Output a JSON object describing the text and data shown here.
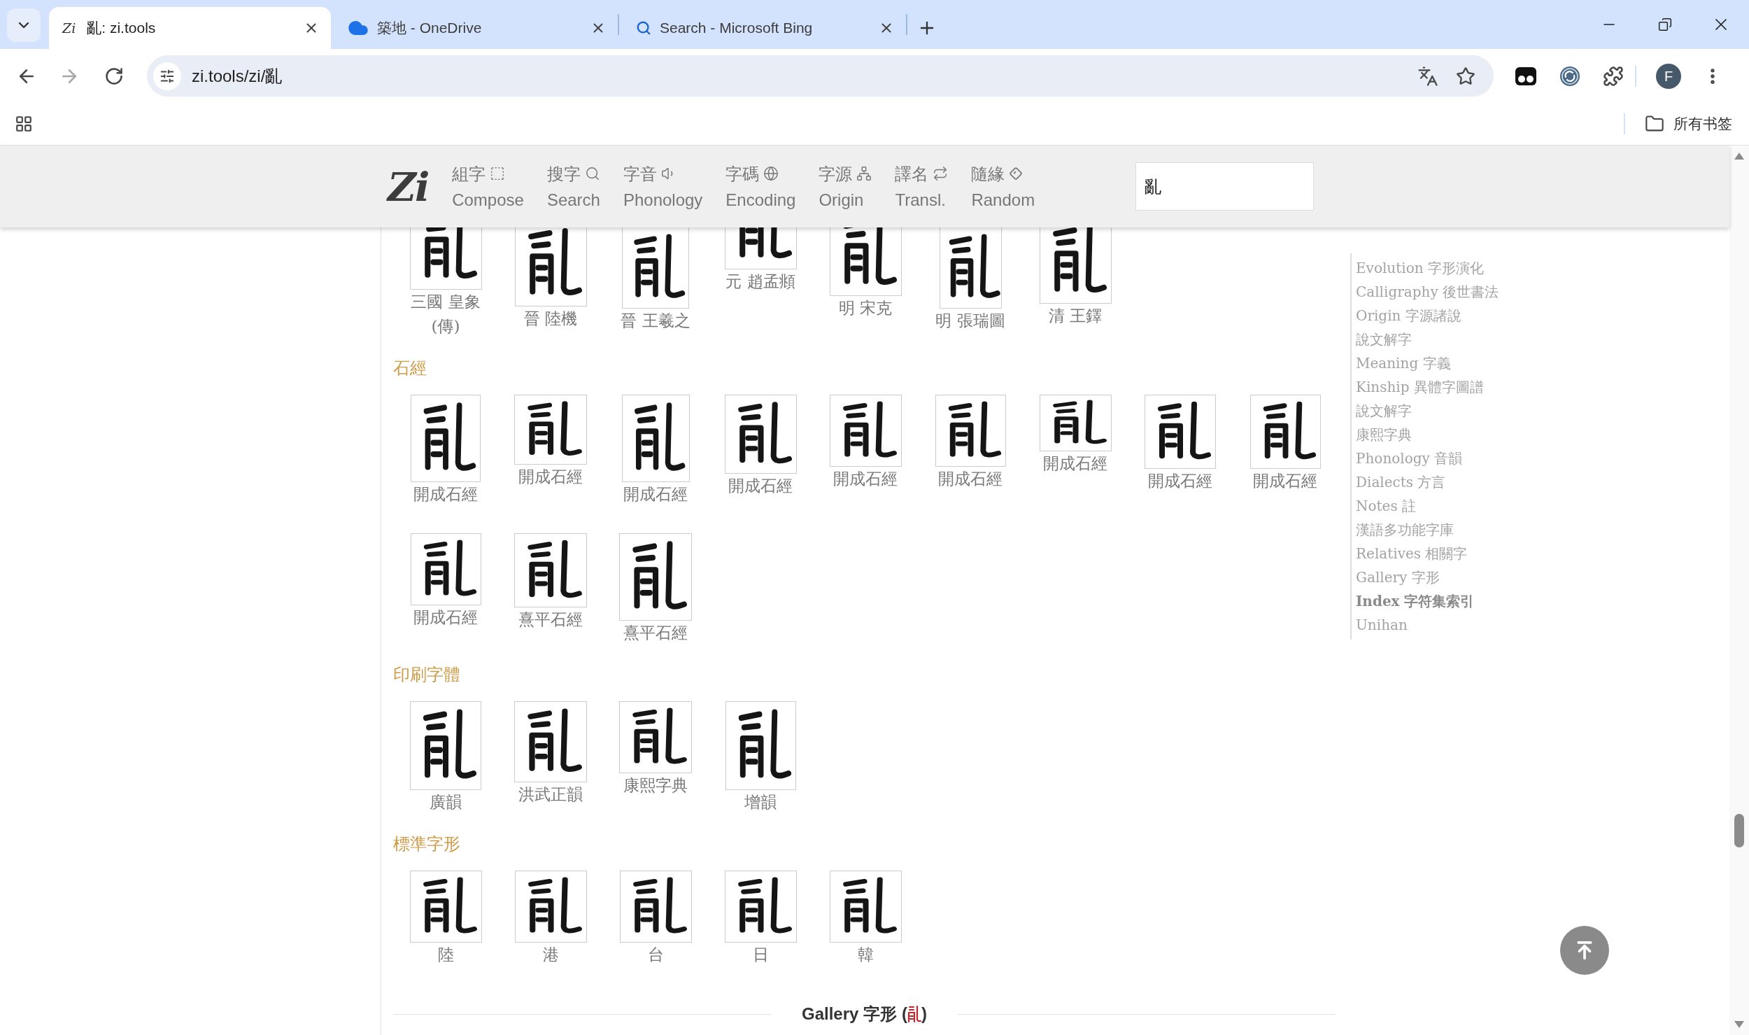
{
  "browser": {
    "tabs": [
      {
        "kind": "site",
        "favicon": "Zi",
        "title": "亂: zi.tools",
        "selected": true
      },
      {
        "kind": "cloud",
        "title": "築地 - OneDrive",
        "selected": false
      },
      {
        "kind": "search",
        "title": "Search - Microsoft Bing",
        "selected": false
      }
    ],
    "address": "zi.tools/zi/亂",
    "profile_initial": "F",
    "bookmarks_folder": "所有书签"
  },
  "site_header": {
    "logo": "Zi",
    "nav": [
      {
        "label": "組字",
        "sublabel": "Compose"
      },
      {
        "label": "搜字",
        "sublabel": "Search"
      },
      {
        "label": "字音",
        "sublabel": "Phonology"
      },
      {
        "label": "字碼",
        "sublabel": "Encoding"
      },
      {
        "label": "字源",
        "sublabel": "Origin"
      },
      {
        "label": "譯名",
        "sublabel": "Transl."
      },
      {
        "label": "隨緣",
        "sublabel": "Random"
      }
    ],
    "search": {
      "value": "亂"
    }
  },
  "gallery": {
    "sections": [
      {
        "items": [
          {
            "caption": "三國 皇象 (傳)"
          },
          {
            "caption": "晉 陸機"
          },
          {
            "caption": "晉 王羲之"
          },
          {
            "caption": "元 趙孟頫"
          },
          {
            "caption": "明 宋克"
          },
          {
            "caption": "明 張瑞圖"
          },
          {
            "caption": "清 王鐸"
          }
        ]
      },
      {
        "heading": "石經",
        "items": [
          {
            "caption": "開成石經"
          },
          {
            "caption": "開成石經"
          },
          {
            "caption": "開成石經"
          },
          {
            "caption": "開成石經"
          },
          {
            "caption": "開成石經"
          },
          {
            "caption": "開成石經"
          },
          {
            "caption": "開成石經"
          },
          {
            "caption": "開成石經"
          },
          {
            "caption": "開成石經"
          },
          {
            "caption": "開成石經"
          },
          {
            "caption": "熹平石經"
          },
          {
            "caption": "熹平石經"
          }
        ]
      },
      {
        "heading": "印刷字體",
        "items": [
          {
            "caption": "廣韻"
          },
          {
            "caption": "洪武正韻"
          },
          {
            "caption": "康熙字典"
          },
          {
            "caption": "增韻"
          }
        ]
      },
      {
        "heading": "標準字形",
        "items": [
          {
            "caption": "陸"
          },
          {
            "caption": "港"
          },
          {
            "caption": "台"
          },
          {
            "caption": "日"
          },
          {
            "caption": "韓"
          }
        ]
      }
    ]
  },
  "gallery_heading": {
    "title": "Gallery 字形",
    "brackets": [
      "(",
      ")"
    ]
  },
  "toc": [
    {
      "label": "Evolution 字形演化",
      "selected": false
    },
    {
      "label": "Calligraphy 後世書法",
      "selected": false
    },
    {
      "label": "Origin 字源諸說",
      "selected": false
    },
    {
      "label": "說文解字",
      "selected": false
    },
    {
      "label": "Meaning 字義",
      "selected": false
    },
    {
      "label": "Kinship 異體字圖譜",
      "selected": false
    },
    {
      "label": "說文解字",
      "selected": false
    },
    {
      "label": "康熙字典",
      "selected": false
    },
    {
      "label": "Phonology 音韻",
      "selected": false
    },
    {
      "label": "Dialects 方言",
      "selected": false
    },
    {
      "label": "Notes 註",
      "selected": false
    },
    {
      "label": "漢語多功能字庫",
      "selected": false
    },
    {
      "label": "Relatives 相關字",
      "selected": false
    },
    {
      "label": "Gallery 字形",
      "selected": false
    },
    {
      "label": "Index 字符集索引",
      "selected": true
    },
    {
      "label": "Unihan",
      "selected": false
    }
  ]
}
